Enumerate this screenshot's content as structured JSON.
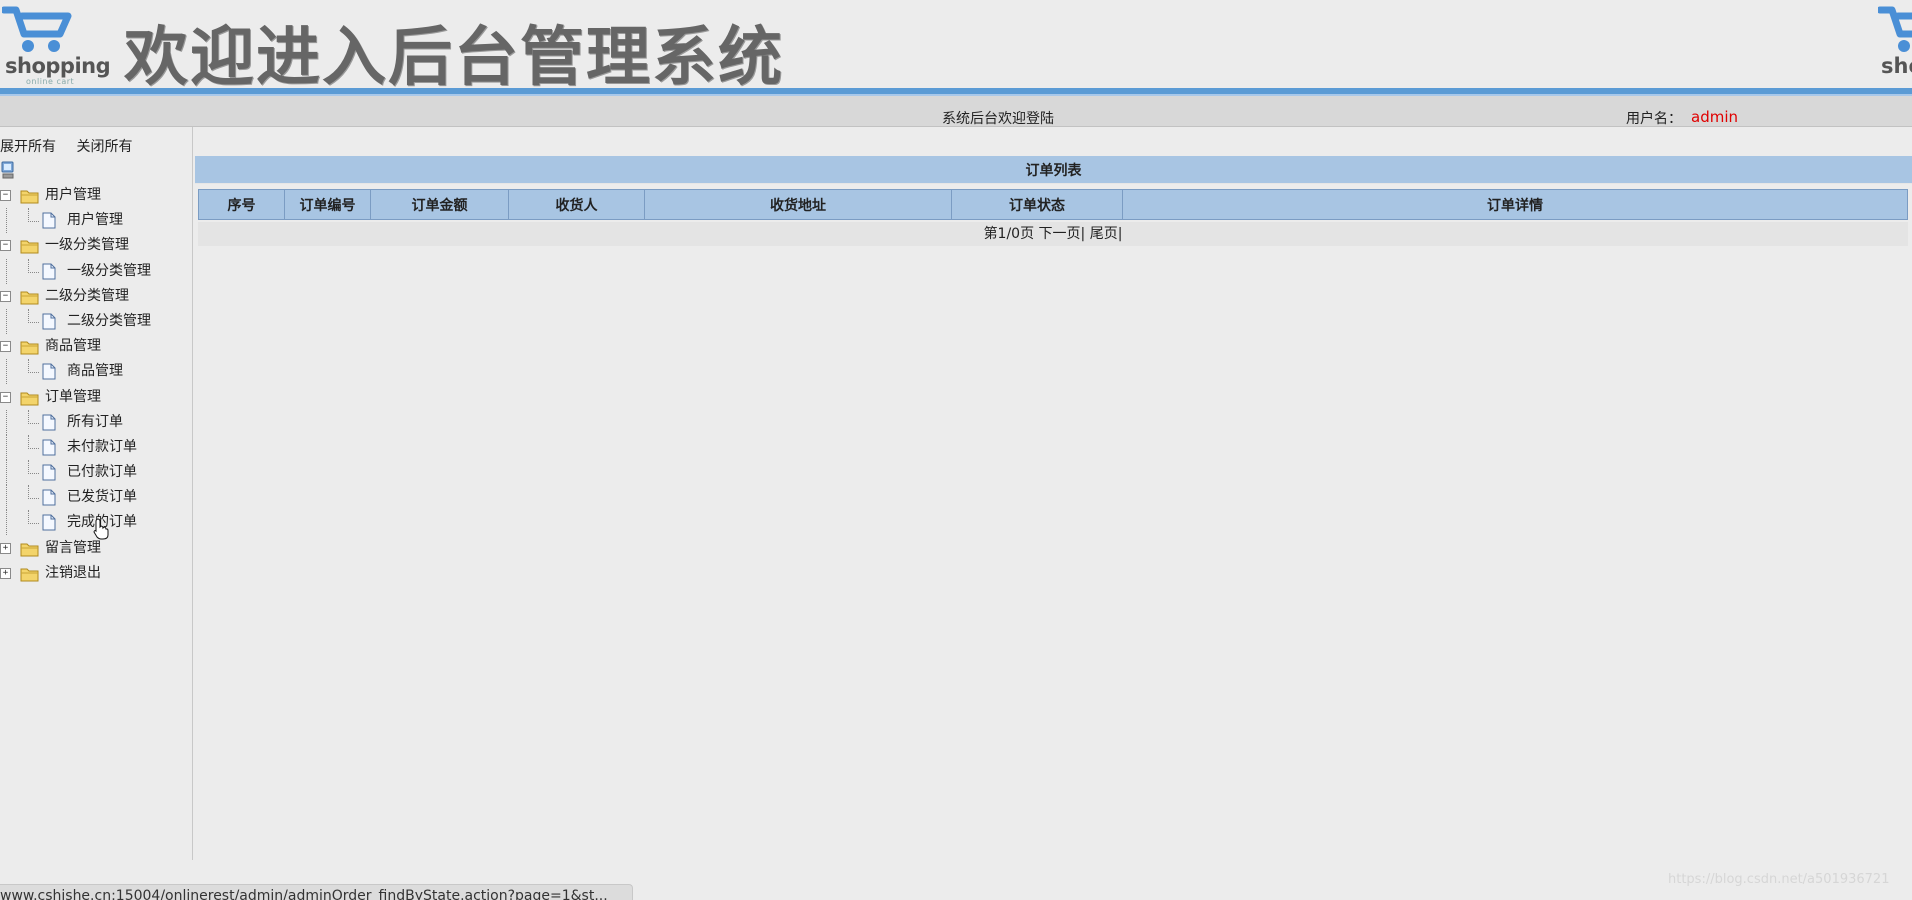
{
  "header": {
    "logo_brand": "shopping",
    "logo_tagline": "online cart",
    "title": "欢迎进入后台管理系统"
  },
  "statusbar": {
    "welcome": "系统后台欢迎登陆",
    "user_label": "用户名：",
    "user_name": "admin"
  },
  "sidebar": {
    "expand_all": "展开所有",
    "close_all": "关闭所有",
    "groups": [
      {
        "label": "用户管理",
        "expanded": true,
        "items": [
          "用户管理"
        ]
      },
      {
        "label": "一级分类管理",
        "expanded": true,
        "items": [
          "一级分类管理"
        ]
      },
      {
        "label": "二级分类管理",
        "expanded": true,
        "items": [
          "二级分类管理"
        ]
      },
      {
        "label": "商品管理",
        "expanded": true,
        "items": [
          "商品管理"
        ]
      },
      {
        "label": "订单管理",
        "expanded": true,
        "items": [
          "所有订单",
          "未付款订单",
          "已付款订单",
          "已发货订单",
          "完成的订单"
        ]
      },
      {
        "label": "留言管理",
        "expanded": false,
        "items": []
      },
      {
        "label": "注销退出",
        "expanded": false,
        "items": []
      }
    ]
  },
  "main": {
    "caption": "订单列表",
    "columns": [
      "序号",
      "订单编号",
      "订单金额",
      "收货人",
      "收货地址",
      "订单状态",
      "订单详情"
    ],
    "pager": {
      "info": "第1/0页",
      "next": "下一页|",
      "last": "尾页|"
    }
  },
  "browser": {
    "status_url": "www.cshishe.cn:15004/onlinerest/admin/adminOrder_findByState.action?page=1&st...",
    "watermark": "https://blog.csdn.net/a501936721"
  },
  "colors": {
    "accent": "#5b9bd5",
    "table_header": "#a8c5e3",
    "user_name": "#e00000"
  }
}
